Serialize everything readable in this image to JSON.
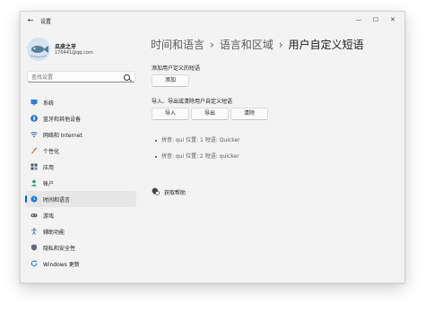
{
  "window": {
    "title": "设置",
    "back_glyph": "←",
    "controls": {
      "minimize": "—",
      "maximize": "☐",
      "close": "✕"
    }
  },
  "user": {
    "name": "瓜皮之牙",
    "email": "170441@qq.com"
  },
  "search": {
    "placeholder": "查找设置"
  },
  "sidebar": {
    "items": [
      {
        "label": "系统",
        "icon": "monitor-icon"
      },
      {
        "label": "蓝牙和其他设备",
        "icon": "bluetooth-icon"
      },
      {
        "label": "网络和 Internet",
        "icon": "wifi-icon"
      },
      {
        "label": "个性化",
        "icon": "brush-icon"
      },
      {
        "label": "应用",
        "icon": "apps-icon"
      },
      {
        "label": "帐户",
        "icon": "account-icon"
      },
      {
        "label": "时间和语言",
        "icon": "clock-globe-icon",
        "active": true
      },
      {
        "label": "游戏",
        "icon": "gamepad-icon"
      },
      {
        "label": "辅助功能",
        "icon": "accessibility-icon"
      },
      {
        "label": "隐私和安全性",
        "icon": "shield-icon"
      },
      {
        "label": "Windows 更新",
        "icon": "update-icon"
      }
    ],
    "accent_color": "#0067c0"
  },
  "breadcrumb": {
    "items": [
      "时间和语言",
      "语言和区域",
      "用户自定义短语"
    ],
    "separator": "›"
  },
  "main": {
    "add_section": {
      "title": "添加用户定义的短语",
      "add_button": "添加"
    },
    "io_section": {
      "title": "导入、导出或清除用户自定义短语",
      "import_button": "导入",
      "export_button": "导出",
      "clear_button": "清除"
    },
    "phrases": [
      {
        "text": "拼音: qui   位置: 1   短语: Quicker"
      },
      {
        "text": "拼音: qui   位置: 2   短语: quicker"
      }
    ],
    "help": {
      "label": "获取帮助"
    }
  }
}
